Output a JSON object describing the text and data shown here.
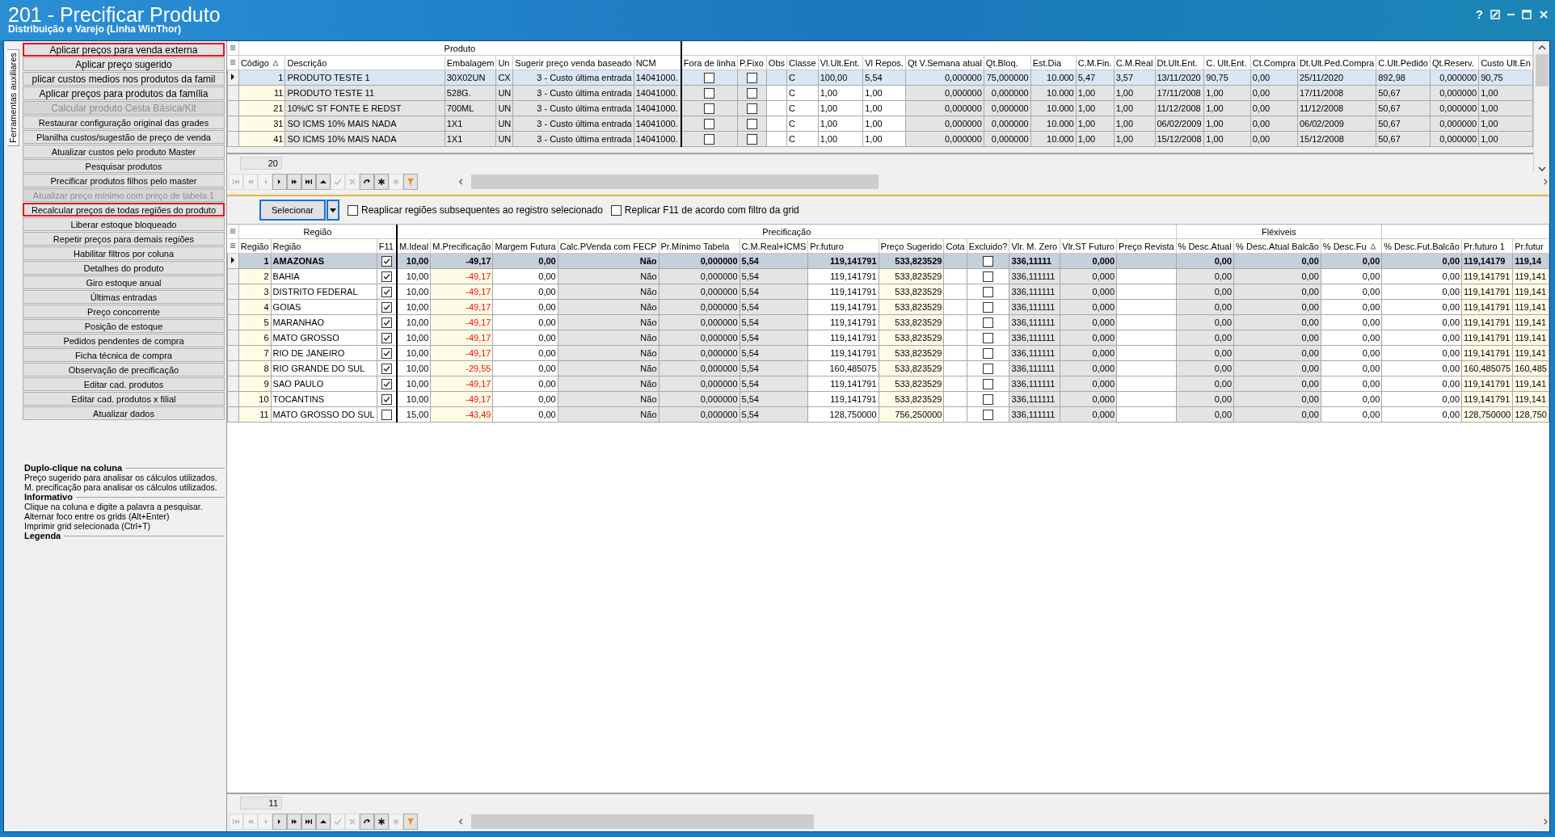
{
  "window": {
    "title": "201 - Precificar Produto",
    "subtitle": "Distribuição e Varejo (Linha WinThor)",
    "help_button": "?"
  },
  "side_tab": {
    "label": "Ferramentas auxiliares"
  },
  "main_actions": [
    {
      "label": "Aplicar preços para venda externa",
      "highlighted": true,
      "disabled": false
    },
    {
      "label": "Aplicar preço sugerido",
      "highlighted": false,
      "disabled": false
    },
    {
      "label": "plicar custos medios nos produtos da famil",
      "highlighted": false,
      "disabled": false
    },
    {
      "label": "Aplicar preços para produtos da família",
      "highlighted": false,
      "disabled": false
    },
    {
      "label": "Calcular produto Cesta Básica/Kit",
      "highlighted": false,
      "disabled": true
    }
  ],
  "actions": [
    {
      "label": "Restaurar configuração original das grades",
      "highlighted": false,
      "disabled": false
    },
    {
      "label": "Planilha custos/sugestão de preço de venda",
      "highlighted": false,
      "disabled": false
    },
    {
      "label": "Atualizar custos pelo produto Master",
      "highlighted": false,
      "disabled": false
    },
    {
      "label": "Pesquisar produtos",
      "highlighted": false,
      "disabled": false
    },
    {
      "label": "Precificar produtos filhos pelo master",
      "highlighted": false,
      "disabled": false
    },
    {
      "label": "Atualizar preço mínimo com preço de tabela 1",
      "highlighted": false,
      "disabled": true
    },
    {
      "label": "Recalcular preços de todas regiões do produto",
      "highlighted": true,
      "disabled": false
    },
    {
      "label": "Liberar estoque bloqueado",
      "highlighted": false,
      "disabled": false
    },
    {
      "label": "Repetir preços para demais regiões",
      "highlighted": false,
      "disabled": false
    },
    {
      "label": "Habilitar filtros por coluna",
      "highlighted": false,
      "disabled": false
    },
    {
      "label": "Detalhes do produto",
      "highlighted": false,
      "disabled": false
    },
    {
      "label": "Giro estoque anual",
      "highlighted": false,
      "disabled": false
    },
    {
      "label": "Últimas entradas",
      "highlighted": false,
      "disabled": false
    },
    {
      "label": "Preço concorrente",
      "highlighted": false,
      "disabled": false
    },
    {
      "label": "Posição de estoque",
      "highlighted": false,
      "disabled": false
    },
    {
      "label": "Pedidos pendentes de compra",
      "highlighted": false,
      "disabled": false
    },
    {
      "label": "Ficha técnica de compra",
      "highlighted": false,
      "disabled": false
    },
    {
      "label": "Observação de precificação",
      "highlighted": false,
      "disabled": false
    },
    {
      "label": "Editar cad. produtos",
      "highlighted": false,
      "disabled": false
    },
    {
      "label": "Editar cad. produtos x filial",
      "highlighted": false,
      "disabled": false
    },
    {
      "label": "Atualizar dados",
      "highlighted": false,
      "disabled": false
    }
  ],
  "help": [
    {
      "heading": "Duplo-clique na coluna",
      "lines": [
        "Preço sugerido para analisar os cálculos utilizados.",
        "M. precificação para analisar os cálculos utilizados."
      ]
    },
    {
      "heading": "Informativo",
      "lines": [
        "Clique na coluna e digite a palavra a pesquisar.",
        "Alternar foco entre os grids (Alt+Enter)",
        "Imprimir grid selecionada (Ctrl+T)"
      ]
    },
    {
      "heading": "Legenda"
    }
  ],
  "product_grid": {
    "groups": [
      {
        "label": "Produto",
        "columns": [
          {
            "label": "Código",
            "sorted": true
          },
          {
            "label": "Descrição",
            "sorted": false
          },
          {
            "label": "Embalagem",
            "sorted": false
          },
          {
            "label": "Un",
            "sorted": false
          },
          {
            "label": "Sugerir preço venda baseado",
            "sorted": false
          },
          {
            "label": "NCM",
            "sorted": false
          }
        ]
      },
      {
        "columns": [
          {
            "label": "Fora de linha",
            "sorted": false
          },
          {
            "label": "P.Fixo",
            "sorted": false
          },
          {
            "label": "Obs",
            "sorted": false
          },
          {
            "label": "Classe",
            "sorted": false
          },
          {
            "label": "Vl.Ult.Ent.",
            "sorted": false
          },
          {
            "label": "Vl Repos.",
            "sorted": false
          },
          {
            "label": "Qt V.Semana atual",
            "sorted": false
          },
          {
            "label": "Qt.Bloq.",
            "sorted": false
          },
          {
            "label": "Est.Dia",
            "sorted": false
          },
          {
            "label": "C.M.Fin.",
            "sorted": false
          },
          {
            "label": "C.M.Real",
            "sorted": false
          },
          {
            "label": "Dt.Ult.Ent.",
            "sorted": false
          },
          {
            "label": "C. Ult.Ent.",
            "sorted": false
          },
          {
            "label": "Ct.Compra",
            "sorted": false
          },
          {
            "label": "Dt.Ult.Ped.Compra",
            "sorted": false
          },
          {
            "label": "C.Ult.Pedido",
            "sorted": false
          },
          {
            "label": "Qt.Reserv.",
            "sorted": false
          },
          {
            "label": "Custo Ult.En",
            "sorted": false
          }
        ]
      }
    ],
    "rows": [
      {
        "selected": true,
        "cells": [
          "1",
          "PRODUTO TESTE 1",
          "30X02UN",
          "CX",
          "3 - Custo última entrada",
          "14041000.",
          false,
          false,
          null,
          "C",
          "100,00",
          "5,54",
          "0,000000",
          "75,000000",
          "10.000",
          "5,47",
          "3,57",
          "13/11/2020",
          "90,75",
          "0,00",
          "25/11/2020",
          "892,98",
          "0,000000",
          "90,75"
        ]
      },
      {
        "selected": false,
        "cells": [
          "11",
          "PRODUTO TESTE 11",
          "528G.",
          "UN",
          "3 - Custo última entrada",
          "14041000.",
          false,
          false,
          null,
          "C",
          "1,00",
          "1,00",
          "0,000000",
          "0,000000",
          "10.000",
          "1,00",
          "1,00",
          "17/11/2008",
          "1,00",
          "0,00",
          "17/11/2008",
          "50,67",
          "0,000000",
          "1,00"
        ]
      },
      {
        "selected": false,
        "cells": [
          "21",
          "10%/C ST FONTE E REDST",
          "700ML",
          "UN",
          "3 - Custo última entrada",
          "14041000.",
          false,
          false,
          null,
          "C",
          "1,00",
          "1,00",
          "0,000000",
          "0,000000",
          "10.000",
          "1,00",
          "1,00",
          "11/12/2008",
          "1,00",
          "0,00",
          "11/12/2008",
          "50,67",
          "0,000000",
          "1,00"
        ]
      },
      {
        "selected": false,
        "cells": [
          "31",
          "SO ICMS 10% MAIS NADA",
          "1X1",
          "UN",
          "3 - Custo última entrada",
          "14041000.",
          false,
          false,
          null,
          "C",
          "1,00",
          "1,00",
          "0,000000",
          "0,000000",
          "10.000",
          "1,00",
          "1,00",
          "06/02/2009",
          "1,00",
          "0,00",
          "06/02/2009",
          "50,67",
          "0,000000",
          "1,00"
        ]
      },
      {
        "selected": false,
        "cells": [
          "41",
          "SO ICMS 10% MAIS NADA",
          "1X1",
          "UN",
          "3 - Custo última entrada",
          "14041000.",
          false,
          false,
          null,
          "C",
          "1,00",
          "1,00",
          "0,000000",
          "0,000000",
          "10.000",
          "1,00",
          "1,00",
          "15/12/2008",
          "1,00",
          "0,00",
          "15/12/2008",
          "50,67",
          "0,000000",
          "1,00"
        ]
      }
    ],
    "record_count": "20",
    "navigator": [
      {
        "kind": "first",
        "disabled": true
      },
      {
        "kind": "prev-page",
        "disabled": true
      },
      {
        "kind": "prev",
        "disabled": true
      },
      {
        "kind": "next",
        "disabled": false
      },
      {
        "kind": "next-page",
        "disabled": false
      },
      {
        "kind": "last",
        "disabled": false
      },
      {
        "kind": "up",
        "disabled": false
      },
      {
        "kind": "confirm",
        "disabled": true
      },
      {
        "kind": "cancel",
        "disabled": true
      },
      {
        "kind": "refresh",
        "disabled": false
      },
      {
        "kind": "add",
        "disabled": false
      },
      {
        "kind": "mark",
        "disabled": true
      },
      {
        "kind": "filter",
        "disabled": false
      }
    ]
  },
  "toolbar": {
    "button": "Selecionar",
    "options": [
      {
        "label": "Reaplicar regiões subsequentes ao registro selecionado",
        "checked": false
      },
      {
        "label": "Replicar F11 de acordo com filtro da grid",
        "checked": false
      }
    ]
  },
  "region_grid": {
    "groups": [
      {
        "label": "Região",
        "columns": [
          {
            "label": "Região",
            "sorted": false
          },
          {
            "label": "Região",
            "sorted": false
          },
          {
            "label": "F11",
            "sorted": false
          }
        ]
      },
      {
        "label": "Precificação",
        "columns": [
          {
            "label": "M.Ideal",
            "sorted": false
          },
          {
            "label": "M.Precificação",
            "sorted": false
          },
          {
            "label": "Margem Futura",
            "sorted": false
          },
          {
            "label": "Calc.PVenda com FECP",
            "sorted": false
          },
          {
            "label": "Pr.Mínimo Tabela",
            "sorted": false
          },
          {
            "label": "C.M.Real+ICMS",
            "sorted": false
          },
          {
            "label": "Pr.futuro",
            "sorted": false
          },
          {
            "label": "Preço Sugerido",
            "sorted": false
          },
          {
            "label": "Cota",
            "sorted": false
          },
          {
            "label": "Excluido?",
            "sorted": false
          },
          {
            "label": "Vlr. M. Zero",
            "sorted": false
          },
          {
            "label": "Vlr.ST Futuro",
            "sorted": false
          },
          {
            "label": "Preço Revista",
            "sorted": false
          }
        ]
      },
      {
        "label": "Fléxiveis",
        "columns": [
          {
            "label": "% Desc.Atual",
            "sorted": false
          },
          {
            "label": "% Desc.Atual Balcão",
            "sorted": false
          },
          {
            "label": "% Desc.Fu",
            "sorted": true
          }
        ]
      },
      {
        "columns": [
          {
            "label": "% Desc.Fut.Balcão",
            "sorted": false
          },
          {
            "label": "Pr.futuro 1",
            "sorted": false
          },
          {
            "label": "Pr.futur",
            "sorted": false
          }
        ]
      }
    ],
    "rows": [
      {
        "selected": true,
        "cells": [
          "1",
          "AMAZONAS",
          true,
          "10,00",
          "-49,17",
          "0,00",
          "Não",
          "0,000000",
          "5,54",
          "119,141791",
          "533,823529",
          null,
          false,
          "336,11111",
          "0,000",
          null,
          "0,00",
          "0,00",
          "0,00",
          "0,00",
          "119,14179",
          "119,14"
        ]
      },
      {
        "selected": false,
        "cells": [
          "2",
          "BAHIA",
          true,
          "10,00",
          "-49,17",
          "0,00",
          "Não",
          "0,000000",
          "5,54",
          "119,141791",
          "533,823529",
          null,
          false,
          "336,111111",
          "0,000",
          null,
          "0,00",
          "0,00",
          "0,00",
          "0,00",
          "119,141791",
          "119,141"
        ]
      },
      {
        "selected": false,
        "cells": [
          "3",
          "DISTRITO FEDERAL",
          true,
          "10,00",
          "-49,17",
          "0,00",
          "Não",
          "0,000000",
          "5,54",
          "119,141791",
          "533,823529",
          null,
          false,
          "336,111111",
          "0,000",
          null,
          "0,00",
          "0,00",
          "0,00",
          "0,00",
          "119,141791",
          "119,141"
        ]
      },
      {
        "selected": false,
        "cells": [
          "4",
          "GOIAS",
          true,
          "10,00",
          "-49,17",
          "0,00",
          "Não",
          "0,000000",
          "5,54",
          "119,141791",
          "533,823529",
          null,
          false,
          "336,111111",
          "0,000",
          null,
          "0,00",
          "0,00",
          "0,00",
          "0,00",
          "119,141791",
          "119,141"
        ]
      },
      {
        "selected": false,
        "cells": [
          "5",
          "MARANHAO",
          true,
          "10,00",
          "-49,17",
          "0,00",
          "Não",
          "0,000000",
          "5,54",
          "119,141791",
          "533,823529",
          null,
          false,
          "336,111111",
          "0,000",
          null,
          "0,00",
          "0,00",
          "0,00",
          "0,00",
          "119,141791",
          "119,141"
        ]
      },
      {
        "selected": false,
        "cells": [
          "6",
          "MATO GROSSO",
          true,
          "10,00",
          "-49,17",
          "0,00",
          "Não",
          "0,000000",
          "5,54",
          "119,141791",
          "533,823529",
          null,
          false,
          "336,111111",
          "0,000",
          null,
          "0,00",
          "0,00",
          "0,00",
          "0,00",
          "119,141791",
          "119,141"
        ]
      },
      {
        "selected": false,
        "cells": [
          "7",
          "RIO DE JANEIRO",
          true,
          "10,00",
          "-49,17",
          "0,00",
          "Não",
          "0,000000",
          "5,54",
          "119,141791",
          "533,823529",
          null,
          false,
          "336,111111",
          "0,000",
          null,
          "0,00",
          "0,00",
          "0,00",
          "0,00",
          "119,141791",
          "119,141"
        ]
      },
      {
        "selected": false,
        "cells": [
          "8",
          "RIO GRANDE DO SUL",
          true,
          "10,00",
          "-29,55",
          "0,00",
          "Não",
          "0,000000",
          "5,54",
          "160,485075",
          "533,823529",
          null,
          false,
          "336,111111",
          "0,000",
          null,
          "0,00",
          "0,00",
          "0,00",
          "0,00",
          "160,485075",
          "160,485"
        ]
      },
      {
        "selected": false,
        "cells": [
          "9",
          "SAO PAULO",
          true,
          "10,00",
          "-49,17",
          "0,00",
          "Não",
          "0,000000",
          "5,54",
          "119,141791",
          "533,823529",
          null,
          false,
          "336,111111",
          "0,000",
          null,
          "0,00",
          "0,00",
          "0,00",
          "0,00",
          "119,141791",
          "119,141"
        ]
      },
      {
        "selected": false,
        "cells": [
          "10",
          "TOCANTINS",
          true,
          "10,00",
          "-49,17",
          "0,00",
          "Não",
          "0,000000",
          "5,54",
          "119,141791",
          "533,823529",
          null,
          false,
          "336,111111",
          "0,000",
          null,
          "0,00",
          "0,00",
          "0,00",
          "0,00",
          "119,141791",
          "119,141"
        ]
      },
      {
        "selected": false,
        "cells": [
          "11",
          "MATO GROSSO DO SUL",
          false,
          "15,00",
          "-43,49",
          "0,00",
          "Não",
          "0,000000",
          "5,54",
          "128,750000",
          "756,250000",
          null,
          false,
          "336,111111",
          "0,000",
          null,
          "0,00",
          "0,00",
          "0,00",
          "0,00",
          "128,750000",
          "128,750"
        ]
      }
    ],
    "record_count": "11",
    "navigator": [
      {
        "kind": "first",
        "disabled": true
      },
      {
        "kind": "prev-page",
        "disabled": true
      },
      {
        "kind": "prev",
        "disabled": true
      },
      {
        "kind": "next",
        "disabled": false
      },
      {
        "kind": "next-page",
        "disabled": false
      },
      {
        "kind": "last",
        "disabled": false
      },
      {
        "kind": "up",
        "disabled": false
      },
      {
        "kind": "confirm",
        "disabled": true
      },
      {
        "kind": "cancel",
        "disabled": true
      },
      {
        "kind": "refresh",
        "disabled": false
      },
      {
        "kind": "add",
        "disabled": false
      },
      {
        "kind": "mark",
        "disabled": true
      },
      {
        "kind": "filter",
        "disabled": false
      }
    ]
  }
}
